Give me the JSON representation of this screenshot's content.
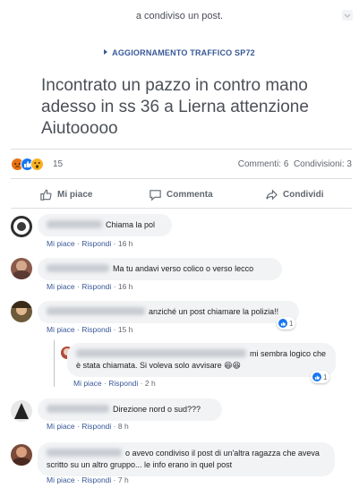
{
  "header": {
    "shared_text": "a condiviso un post.",
    "more_icon": "chevron-down-icon"
  },
  "post": {
    "group_name": "AGGIORNAMENTO TRAFFICO SP72",
    "text": "Incontrato un pazzo in contro mano adesso in ss 36 a Lierna attenzione Aiutooooo",
    "reaction_count": "15",
    "stats": "Commenti: 6  Condivisioni: 3"
  },
  "actions": {
    "like": "Mi piace",
    "comment": "Commenta",
    "share": "Condividi"
  },
  "comments": [
    {
      "text": "Chiama la pol",
      "like": "Mi piace",
      "reply": "Rispondi",
      "time": "16 h"
    },
    {
      "text": "Ma tu andavi verso colico o verso lecco",
      "like": "Mi piace",
      "reply": "Rispondi",
      "time": "16 h"
    },
    {
      "text": "anziché un post chiamare la polizia!!",
      "like": "Mi piace",
      "reply": "Rispondi",
      "time": "15 h",
      "likes": "1"
    },
    {
      "text": "mi sembra logico che è stata chiamata. Si voleva solo avvisare 😆😆",
      "like": "Mi piace",
      "reply": "Rispondi",
      "time": "2 h",
      "likes": "1"
    },
    {
      "text": "Direzione nord o sud???",
      "like": "Mi piace",
      "reply": "Rispondi",
      "time": "8 h"
    },
    {
      "text": "o avevo condiviso il post di un'altra ragazza che aveva scritto su un altro gruppo... le info erano in quel post",
      "like": "Mi piace",
      "reply": "Rispondi",
      "time": "7 h"
    }
  ],
  "colors": {
    "link": "#385898",
    "like_blue": "#1877f2",
    "bubble": "#f2f3f5"
  }
}
